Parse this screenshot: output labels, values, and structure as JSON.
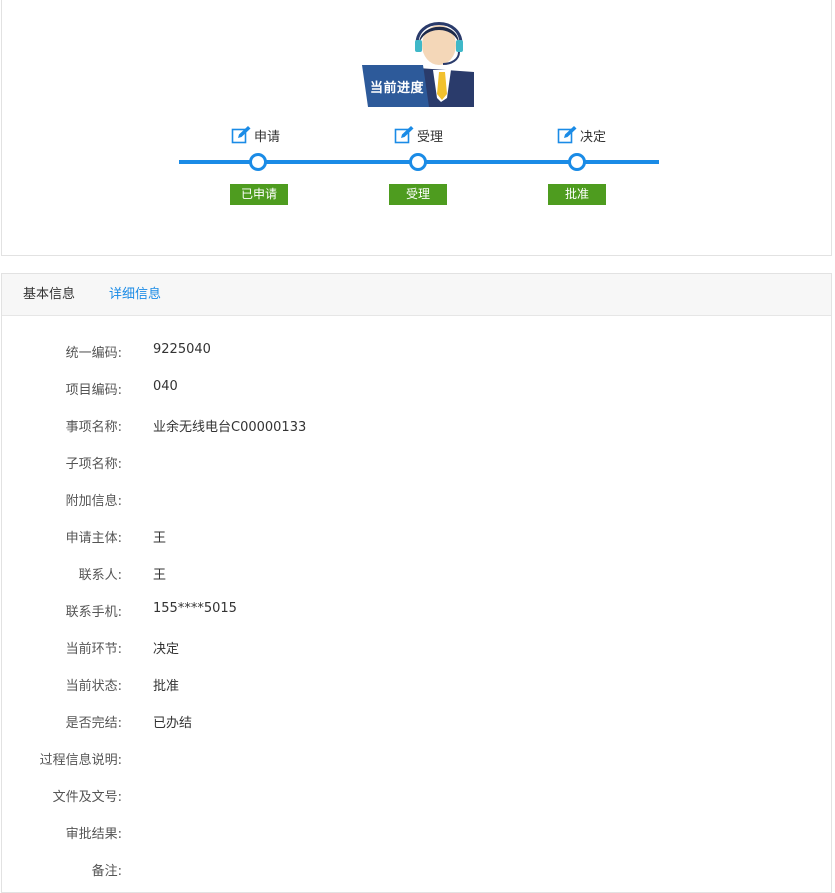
{
  "progress": {
    "badge_text": "当前进度",
    "steps": [
      {
        "label": "申请",
        "status": "已申请"
      },
      {
        "label": "受理",
        "status": "受理"
      },
      {
        "label": "决定",
        "status": "批准"
      }
    ],
    "colors": {
      "track": "#1a8be6",
      "status": "#4e9c1f",
      "badge": "#2d4f8a"
    }
  },
  "tabs": {
    "basic": "基本信息",
    "detail": "详细信息"
  },
  "fields": [
    {
      "label": "统一编码:",
      "value": "9225040"
    },
    {
      "label": "项目编码:",
      "value": "040"
    },
    {
      "label": "事项名称:",
      "value": "业余无线电台C00000133"
    },
    {
      "label": "子项名称:",
      "value": ""
    },
    {
      "label": "附加信息:",
      "value": ""
    },
    {
      "label": "申请主体:",
      "value": "王"
    },
    {
      "label": "联系人:",
      "value": "王"
    },
    {
      "label": "联系手机:",
      "value": "155****5015"
    },
    {
      "label": "当前环节:",
      "value": "决定"
    },
    {
      "label": "当前状态:",
      "value": "批准"
    },
    {
      "label": "是否完结:",
      "value": "已办结"
    },
    {
      "label": "过程信息说明:",
      "value": ""
    },
    {
      "label": "文件及文号:",
      "value": ""
    },
    {
      "label": "审批结果:",
      "value": ""
    },
    {
      "label": "备注:",
      "value": ""
    }
  ]
}
